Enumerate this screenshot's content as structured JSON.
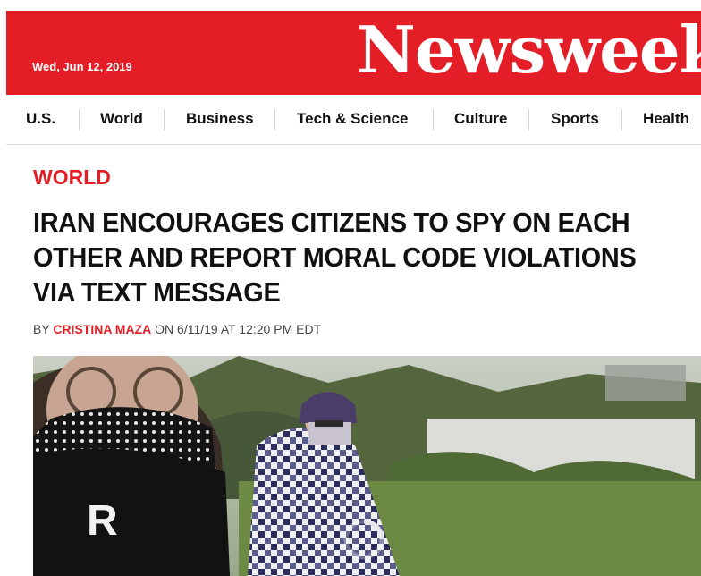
{
  "masthead": {
    "date": "Wed, Jun 12, 2019",
    "logo": "Newsweek",
    "brand_color": "#e41e26"
  },
  "nav": {
    "items": [
      {
        "label": "U.S."
      },
      {
        "label": "World"
      },
      {
        "label": "Business"
      },
      {
        "label": "Tech & Science"
      },
      {
        "label": "Culture"
      },
      {
        "label": "Sports"
      },
      {
        "label": "Health"
      }
    ]
  },
  "article": {
    "section": "WORLD",
    "headline_lines": [
      "IRAN ENCOURAGES CITIZENS TO SPY ON EACH",
      "OTHER AND REPORT MORAL CODE VIOLATIONS",
      "VIA TEXT MESSAGE"
    ],
    "byline": {
      "prefix": "BY",
      "author": "CRISTINA MAZA",
      "on": "ON",
      "datetime": "6/11/19 AT 12:20 PM EDT"
    }
  },
  "hero": {
    "icon": "loading-spinner-icon"
  }
}
